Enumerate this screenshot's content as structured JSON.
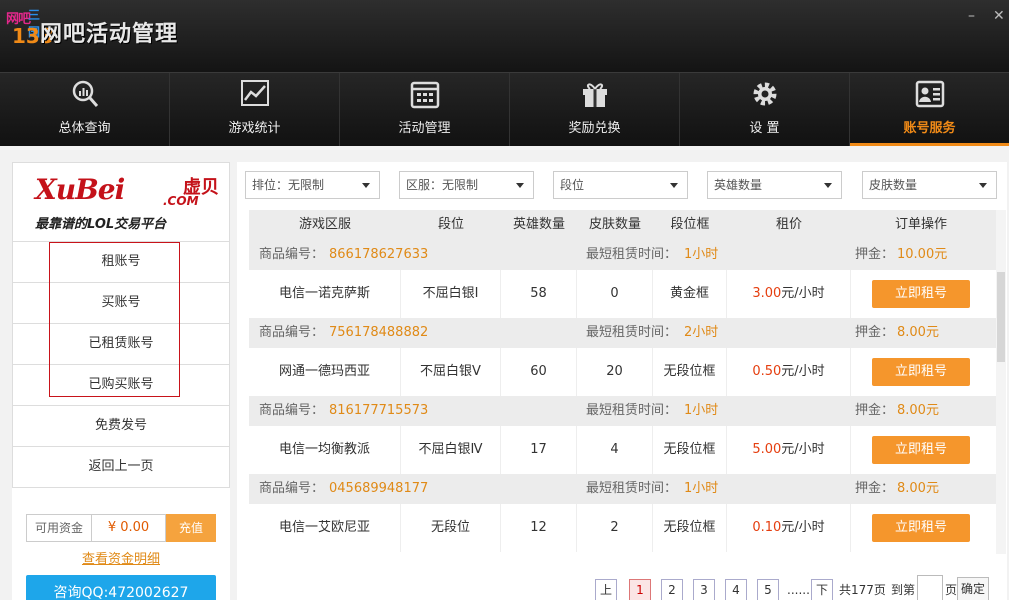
{
  "app": {
    "title": "网吧活动管理",
    "logo_top": "网吧",
    "logo_top2": "三国",
    "logo_bottom": "133"
  },
  "window": {
    "minimize": "–",
    "close": "✕"
  },
  "nav": [
    {
      "label": "总体查询",
      "icon": "search-chart-icon"
    },
    {
      "label": "游戏统计",
      "icon": "line-chart-icon"
    },
    {
      "label": "活动管理",
      "icon": "calendar-icon"
    },
    {
      "label": "奖励兑换",
      "icon": "gift-icon"
    },
    {
      "label": "设 置",
      "icon": "gear-icon"
    },
    {
      "label": "账号服务",
      "icon": "id-card-icon",
      "active": true
    }
  ],
  "sidebar": {
    "brand_logo": "XuBei",
    "brand_cn": "虚贝",
    "brand_com": ".COM",
    "brand_slogan": "最靠谱的LOL交易平台",
    "items": [
      "租账号",
      "买账号",
      "已租赁账号",
      "已购买账号",
      "免费发号",
      "返回上一页"
    ],
    "fund_label": "可用资金",
    "fund_value": "¥ 0.00",
    "recharge": "充值",
    "fund_link": "查看资金明细",
    "qq": "咨询QQ:472002627"
  },
  "filters": [
    "排位：无限制",
    "区服：无限制",
    "段位",
    "英雄数量",
    "皮肤数量"
  ],
  "table": {
    "headers": [
      "游戏区服",
      "段位",
      "英雄数量",
      "皮肤数量",
      "段位框",
      "租价",
      "订单操作"
    ],
    "item_no_label": "商品编号：",
    "min_time_label": "最短租赁时间：",
    "deposit_label": "押金：",
    "unit": "元/小时",
    "rent_label": "立即租号",
    "rows": [
      {
        "item_no": "866178627633",
        "min_time": "1小时",
        "deposit": "10.00元",
        "server": "电信一诺克萨斯",
        "rank": "不屈白银Ⅰ",
        "heroes": "58",
        "skins": "0",
        "frame": "黄金框",
        "price": "3.00"
      },
      {
        "item_no": "756178488882",
        "min_time": "2小时",
        "deposit": "8.00元",
        "server": "网通一德玛西亚",
        "rank": "不屈白银Ⅴ",
        "heroes": "60",
        "skins": "20",
        "frame": "无段位框",
        "price": "0.50"
      },
      {
        "item_no": "816177715573",
        "min_time": "1小时",
        "deposit": "8.00元",
        "server": "电信一均衡教派",
        "rank": "不屈白银Ⅳ",
        "heroes": "17",
        "skins": "4",
        "frame": "无段位框",
        "price": "5.00"
      },
      {
        "item_no": "045689948177",
        "min_time": "1小时",
        "deposit": "8.00元",
        "server": "电信一艾欧尼亚",
        "rank": "无段位",
        "heroes": "12",
        "skins": "2",
        "frame": "无段位框",
        "price": "0.10"
      }
    ]
  },
  "pager": {
    "prev": "上",
    "pages": [
      "1",
      "2",
      "3",
      "4",
      "5"
    ],
    "current": "1",
    "ellipsis": "......",
    "next": "下",
    "total": "共177页",
    "goto": "到第",
    "page_suffix": "页",
    "ok": "确定"
  },
  "colors": {
    "accent": "#f08a17",
    "brand_red": "#c4121a",
    "qq_blue": "#1ea6ea",
    "price_red": "#e53e0f"
  }
}
